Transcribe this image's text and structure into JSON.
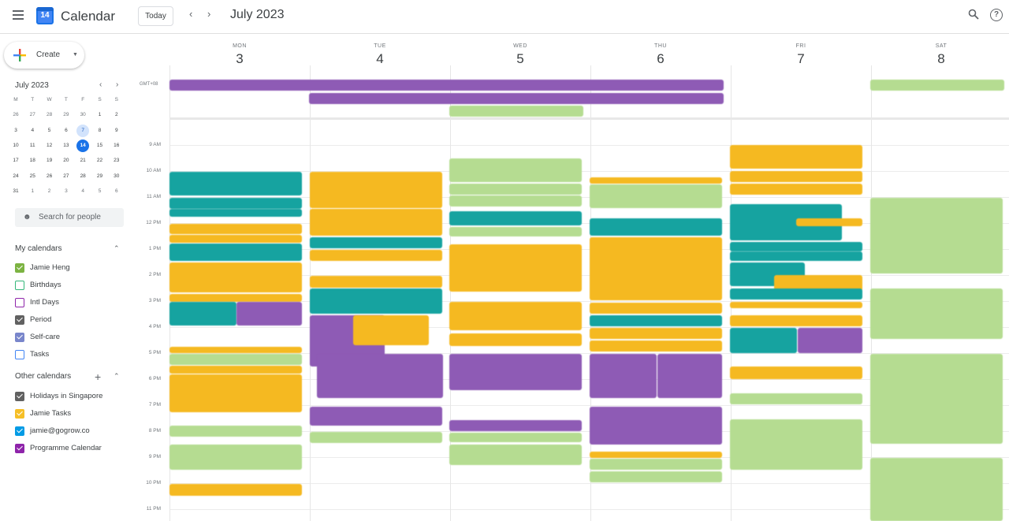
{
  "header": {
    "app_title": "Calendar",
    "logo_day": "14",
    "today_label": "Today",
    "prev_icon": "chevron-left-icon",
    "next_icon": "chevron-right-icon",
    "month_title": "July 2023"
  },
  "sidebar": {
    "create_label": "Create",
    "mini_calendar": {
      "title": "July 2023",
      "weekday_heads": [
        "M",
        "T",
        "W",
        "T",
        "F",
        "S",
        "S"
      ],
      "weeks": [
        [
          "26",
          "27",
          "28",
          "29",
          "30",
          "1",
          "2"
        ],
        [
          "3",
          "4",
          "5",
          "6",
          "7",
          "8",
          "9"
        ],
        [
          "10",
          "11",
          "12",
          "13",
          "14",
          "15",
          "16"
        ],
        [
          "17",
          "18",
          "19",
          "20",
          "21",
          "22",
          "23"
        ],
        [
          "24",
          "25",
          "26",
          "27",
          "28",
          "29",
          "30"
        ],
        [
          "31",
          "1",
          "2",
          "3",
          "4",
          "5",
          "6"
        ]
      ],
      "selected": "7",
      "today": "14"
    },
    "search_people": "Search for people",
    "my_calendars_title": "My calendars",
    "my_calendars": [
      {
        "label": "Jamie Heng",
        "color": "#7cb342",
        "checked": true
      },
      {
        "label": "Birthdays",
        "color": "#33b679",
        "checked": false
      },
      {
        "label": "Intl Days",
        "color": "#8e24aa",
        "checked": false
      },
      {
        "label": "Period",
        "color": "#616161",
        "checked": true
      },
      {
        "label": "Self-care",
        "color": "#7986cb",
        "checked": true
      },
      {
        "label": "Tasks",
        "color": "#4285f4",
        "checked": false
      }
    ],
    "other_calendars_title": "Other calendars",
    "other_calendars": [
      {
        "label": "Holidays in Singapore",
        "color": "#616161",
        "checked": true
      },
      {
        "label": "Jamie Tasks",
        "color": "#f6bf26",
        "checked": true
      },
      {
        "label": "jamie@gogrow.co",
        "color": "#039be5",
        "checked": true
      },
      {
        "label": "Programme Calendar",
        "color": "#8e24aa",
        "checked": true
      }
    ]
  },
  "week": {
    "timezone": "GMT+08",
    "days": [
      {
        "dow": "MON",
        "num": "3"
      },
      {
        "dow": "TUE",
        "num": "4"
      },
      {
        "dow": "WED",
        "num": "5"
      },
      {
        "dow": "THU",
        "num": "6"
      },
      {
        "dow": "FRI",
        "num": "7"
      },
      {
        "dow": "SAT",
        "num": "8"
      }
    ],
    "hours": [
      "9 AM",
      "10 AM",
      "11 AM",
      "12 PM",
      "1 PM",
      "2 PM",
      "3 PM",
      "4 PM",
      "5 PM",
      "6 PM",
      "7 PM",
      "8 PM",
      "9 PM",
      "10 PM",
      "11 PM"
    ]
  },
  "colors": {
    "purple": "#8e5bb5",
    "teal": "#16a3a0",
    "yellow": "#f5b921",
    "green": "#b5dc91",
    "today_blue": "#1a73e8"
  }
}
